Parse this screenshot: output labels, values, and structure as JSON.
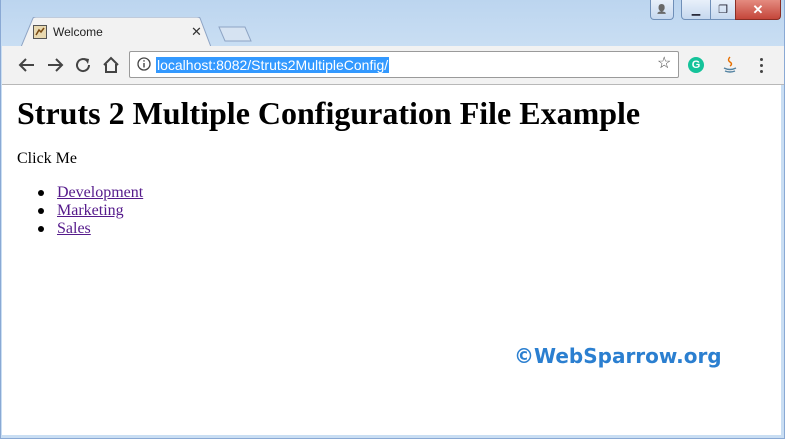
{
  "browser": {
    "tab": {
      "title": "Welcome",
      "close_glyph": "✕",
      "favicon": "tomcat-favicon"
    },
    "window_controls": {
      "user_glyph": "👤",
      "minimize_glyph": "▁",
      "maximize_glyph": "❐",
      "close_glyph": "✕"
    },
    "nav": {
      "back_icon": "back-arrow-icon",
      "forward_icon": "forward-arrow-icon",
      "reload_icon": "reload-icon",
      "home_icon": "home-icon"
    },
    "address_bar": {
      "url": "localhost:8082/Struts2MultipleConfig/",
      "selected": true,
      "selection_color": "#3399ff"
    },
    "bookmark_glyph": "☆",
    "extensions": {
      "grammarly_label": "G",
      "grammarly_color": "#15c39a",
      "java_icon": "java-icon"
    }
  },
  "page": {
    "heading": "Struts 2 Multiple Configuration File Example",
    "click_me": "Click Me",
    "links": [
      "Development",
      "Marketing",
      "Sales"
    ],
    "link_color": "#551a8b",
    "watermark": "©WebSparrow.org",
    "watermark_color": "#2b7fd0"
  }
}
